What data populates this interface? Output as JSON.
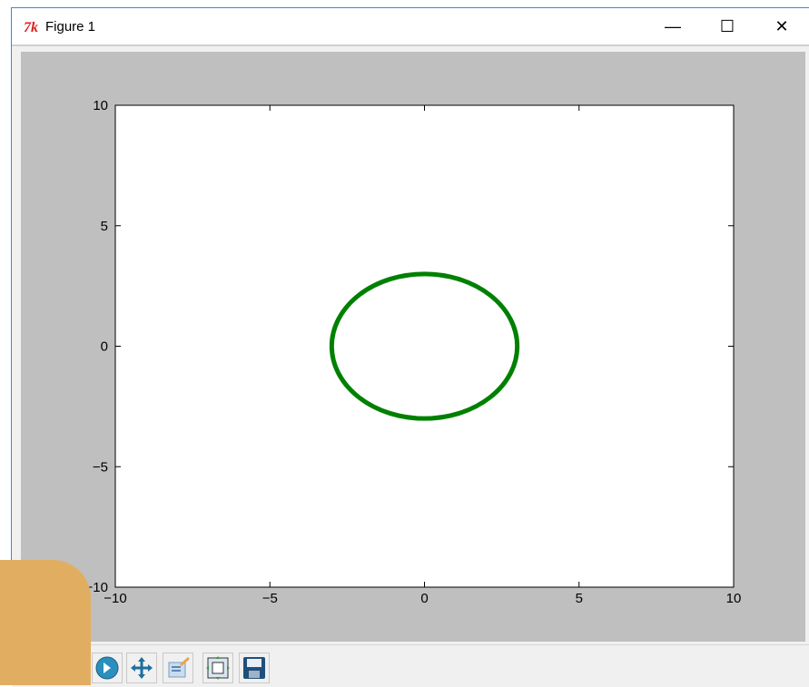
{
  "window": {
    "title": "Figure 1",
    "controls": {
      "minimize": "—",
      "maximize": "☐",
      "close": "✕"
    }
  },
  "icons": {
    "app": "tk-icon",
    "toolbar": [
      "forward-icon",
      "pan-icon",
      "zoom-icon",
      "subplots-icon",
      "save-icon"
    ]
  },
  "chart_data": {
    "type": "line",
    "title": "",
    "xlabel": "",
    "ylabel": "",
    "xlim": [
      -10,
      10
    ],
    "ylim": [
      -10,
      10
    ],
    "xticks": [
      -10,
      -5,
      0,
      5,
      10
    ],
    "yticks": [
      -10,
      -5,
      0,
      5,
      10
    ],
    "xtick_labels": [
      "−10",
      "−5",
      "0",
      "5",
      "10"
    ],
    "ytick_labels": [
      "−10",
      "−5",
      "0",
      "5",
      "10"
    ],
    "grid": false,
    "series": [
      {
        "shape": "ellipse",
        "center": [
          0,
          0
        ],
        "radius_x": 3,
        "radius_y": 3,
        "color": "#008000"
      }
    ]
  },
  "colors": {
    "figure_bg": "#bfbfbf",
    "axes_bg": "#ffffff",
    "series": "#008000",
    "overlay": "#e1ae61"
  }
}
